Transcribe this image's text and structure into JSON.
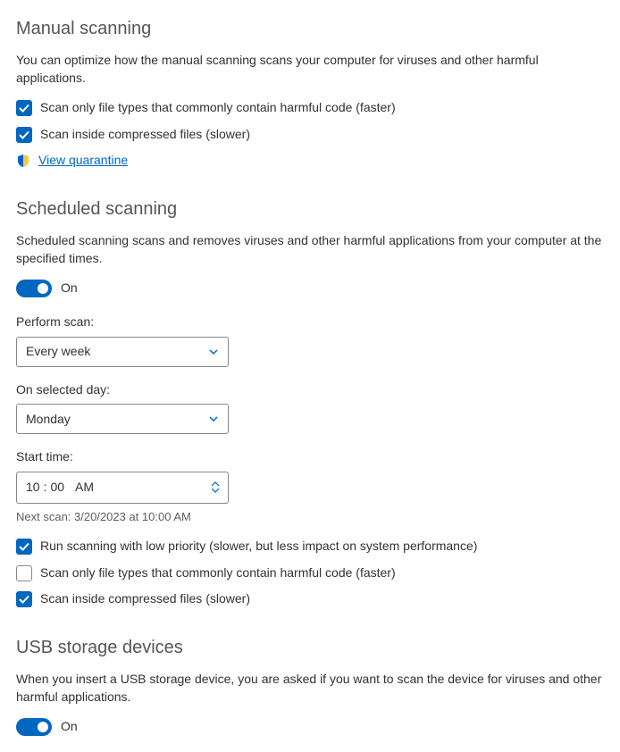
{
  "manual": {
    "title": "Manual scanning",
    "desc": "You can optimize how the manual scanning scans your computer for viruses and other harmful applications.",
    "opt_filetypes": "Scan only file types that commonly contain harmful code (faster)",
    "opt_compressed": "Scan inside compressed files (slower)",
    "quarantine_link": "View quarantine"
  },
  "scheduled": {
    "title": "Scheduled scanning",
    "desc": "Scheduled scanning scans and removes viruses and other harmful applications from your computer at the specified times.",
    "toggle_label": "On",
    "perform_label": "Perform scan:",
    "perform_value": "Every week",
    "day_label": "On selected day:",
    "day_value": "Monday",
    "start_label": "Start time:",
    "start_hour": "10",
    "start_min": "00",
    "start_ampm": "AM",
    "next_scan": "Next scan: 3/20/2023 at 10:00 AM",
    "opt_lowpriority": "Run scanning with low priority (slower, but less impact on system performance)",
    "opt_filetypes": "Scan only file types that commonly contain harmful code (faster)",
    "opt_compressed": "Scan inside compressed files (slower)"
  },
  "usb": {
    "title": "USB storage devices",
    "desc": "When you insert a USB storage device, you are asked if you want to scan the device for viruses and other harmful applications.",
    "toggle_label": "On"
  }
}
